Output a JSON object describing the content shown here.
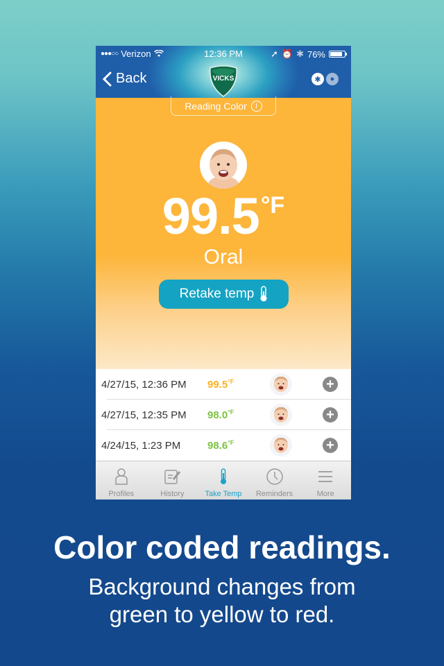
{
  "status_bar": {
    "signal_dots": "●●●○○",
    "carrier": "Verizon",
    "time": "12:36 PM",
    "battery": "76%",
    "battery_level": 0.76
  },
  "nav": {
    "back_label": "Back",
    "logo_text": "VICKS"
  },
  "hero": {
    "reading_color_label": "Reading Color",
    "temperature": "99.5",
    "unit": "°F",
    "method": "Oral",
    "retake_label": "Retake temp",
    "background_color": "#fdb53a"
  },
  "readings": [
    {
      "date": "4/27/15, 12:36 PM",
      "temp": "99.5",
      "unit": "°F",
      "color": "#fbb123"
    },
    {
      "date": "4/27/15, 12:35 PM",
      "temp": "98.0",
      "unit": "°F",
      "color": "#7dc243"
    },
    {
      "date": "4/24/15, 1:23 PM",
      "temp": "98.6",
      "unit": "°F",
      "color": "#7dc243"
    }
  ],
  "tabs": [
    {
      "label": "Profiles",
      "icon": "person-icon"
    },
    {
      "label": "History",
      "icon": "notes-icon"
    },
    {
      "label": "Take Temp",
      "icon": "thermometer-icon",
      "active": true
    },
    {
      "label": "Reminders",
      "icon": "clock-icon"
    },
    {
      "label": "More",
      "icon": "menu-icon"
    }
  ],
  "caption": {
    "headline": "Color coded readings.",
    "line1": "Background changes from",
    "line2": "green to yellow to red."
  }
}
